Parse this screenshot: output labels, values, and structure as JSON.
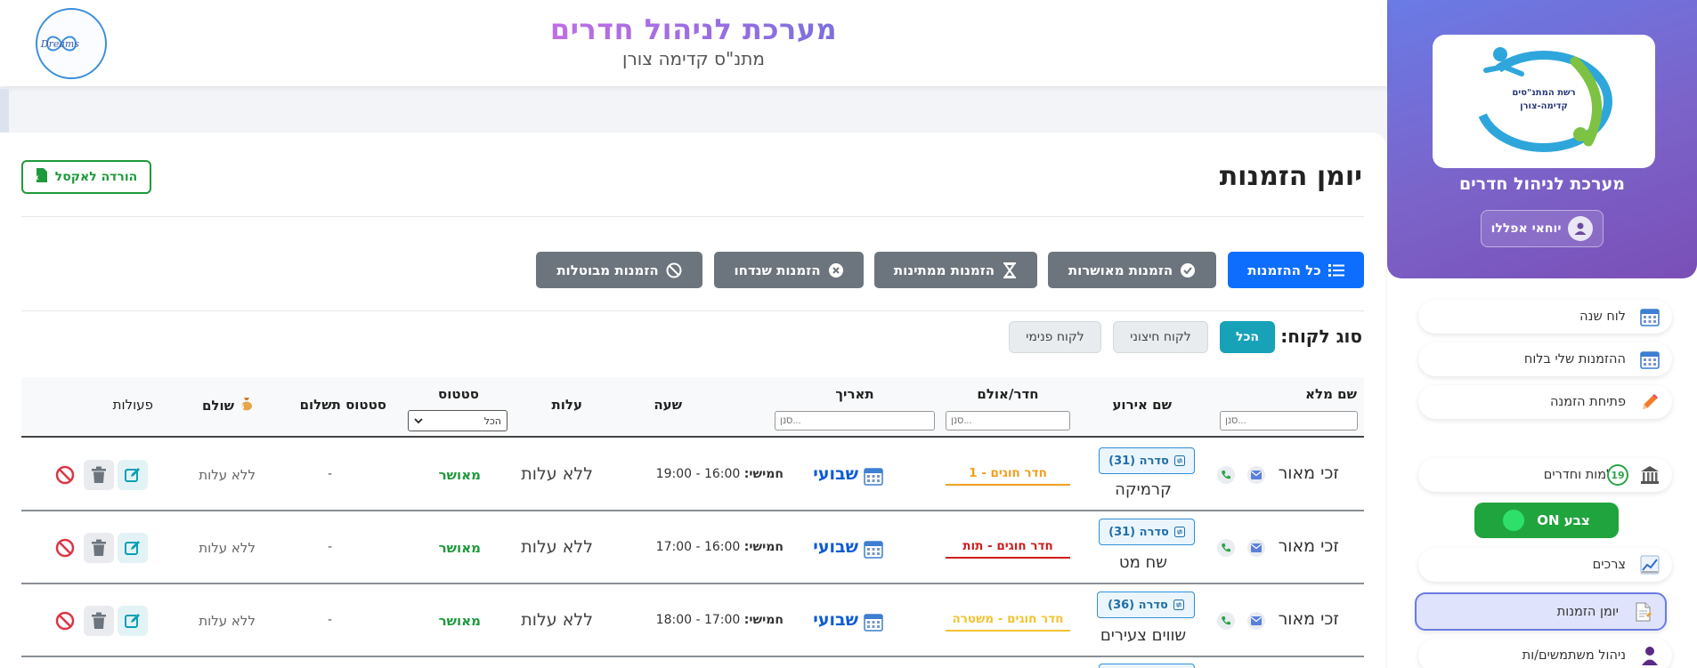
{
  "app": {
    "title": "מערכת לניהול חדרים",
    "subtitle": "מתנ\"ס קדימה צורן"
  },
  "sidebar": {
    "logo_text": "רשת המתנ\"סים קדימה-צורן",
    "brand_title": "מערכת לניהול חדרים",
    "user_name": "יוחאי אפללו",
    "toggle_label": "צבע ON",
    "items": [
      {
        "label": "לוח שנה",
        "icon": "calendar-icon"
      },
      {
        "label": "ההזמנות שלי בלוח",
        "icon": "calendar-grid-icon"
      },
      {
        "label": "פתיחת הזמנה",
        "icon": "pencil-icon"
      },
      {
        "label": "אולמות וחדרים",
        "icon": "building-icon",
        "badge": "19"
      },
      {
        "label": "צרכים",
        "icon": "chart-icon"
      },
      {
        "label": "יומן הזמנות",
        "icon": "document-icon",
        "active": true
      },
      {
        "label": "ניהול משתמשים/ות",
        "icon": "user-icon"
      }
    ]
  },
  "dreams_logo": "Dreams",
  "page": {
    "title": "יומן הזמנות",
    "excel_button": "הורדה לאקסל"
  },
  "filters": [
    {
      "label": "כל ההזמנות",
      "icon": "list-icon",
      "active": true
    },
    {
      "label": "הזמנות מאושרות",
      "icon": "check-circle-icon"
    },
    {
      "label": "הזמנות ממתינות",
      "icon": "hourglass-icon"
    },
    {
      "label": "הזמנות שנדחו",
      "icon": "x-circle-icon"
    },
    {
      "label": "הזמנות מבוטלות",
      "icon": "ban-icon"
    }
  ],
  "customer_type": {
    "label": "סוג לקוח:",
    "options": [
      "הכל",
      "לקוח חיצוני",
      "לקוח פנימי"
    ],
    "selected": "הכל"
  },
  "table": {
    "headers": {
      "full_name": "שם מלא",
      "event_name": "שם אירוע",
      "room": "חדר/אולם",
      "date": "תאריך",
      "time": "שעה",
      "cost": "עלות",
      "status": "סטטוס",
      "payment_status": "סטטוס תשלום",
      "paid": "שולם",
      "actions": "פעולות"
    },
    "filter_placeholder": "סנן...",
    "status_filter_value": "הכל",
    "rows": [
      {
        "name": "זכי מאור",
        "series": "סדרה (31)",
        "event": "קרמיקה",
        "room": "חדר חוגים - 1",
        "room_color": "#f0a020",
        "date": "שבועי",
        "day": "חמישי:",
        "time": "16:00 - 19:00",
        "cost": "ללא עלות",
        "status": "מאושר",
        "payment_status": "-",
        "paid": "ללא עלות"
      },
      {
        "name": "זכי מאור",
        "series": "סדרה (31)",
        "event": "שח מט",
        "room": "חדר חוגים - תות",
        "room_color": "#d01c1c",
        "date": "שבועי",
        "day": "חמישי:",
        "time": "16:00 - 17:00",
        "cost": "ללא עלות",
        "status": "מאושר",
        "payment_status": "-",
        "paid": "ללא עלות"
      },
      {
        "name": "זכי מאור",
        "series": "סדרה (36)",
        "event": "שווים צעירים",
        "room": "חדר חוגים - משטרה",
        "room_color": "#f2c430",
        "date": "שבועי",
        "day": "חמישי:",
        "time": "17:00 - 18:00",
        "cost": "ללא עלות",
        "status": "מאושר",
        "payment_status": "-",
        "paid": "ללא עלות"
      }
    ]
  }
}
